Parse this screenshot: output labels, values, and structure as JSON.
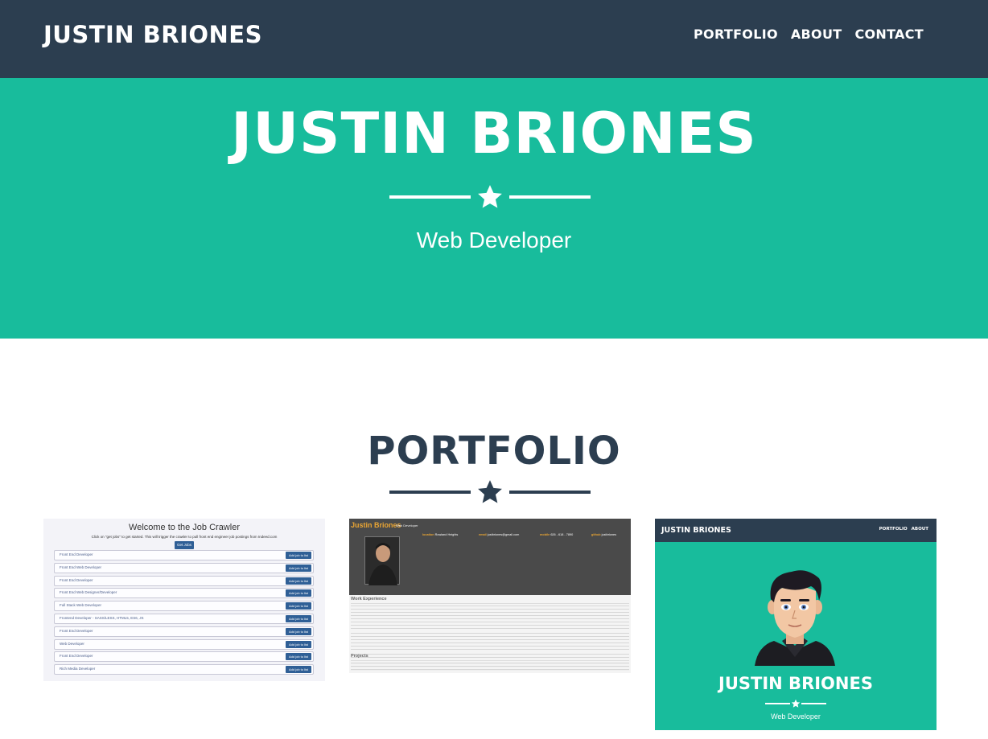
{
  "navbar": {
    "brand": "JUSTIN BRIONES",
    "links": [
      "PORTFOLIO",
      "ABOUT",
      "CONTACT"
    ]
  },
  "hero": {
    "title": "JUSTIN BRIONES",
    "subtitle": "Web Developer"
  },
  "portfolio": {
    "title": "PORTFOLIO",
    "job_crawler": {
      "title": "Welcome to the Job Crawler",
      "description": "Click on \"get jobs\" to get started. This will trigger the crawler to pull front end engineer job postings from Indeed.com",
      "get_jobs_label": "Get Jobs",
      "add_label": "Add job to list",
      "jobs": [
        "Front End Developer",
        "Front End Web Developer",
        "Front End Developer",
        "Front End Web Designer/Developer",
        "Full Stack Web Developer",
        "Frontend Developer - SASS/LESS, HTML5, ES6, JS",
        "Front End Developer",
        "Web Developer",
        "Front End Developer",
        "Rich Media Developer"
      ]
    },
    "resume": {
      "name": "Justin Briones",
      "role": "Web Developer",
      "info": [
        {
          "label": "location",
          "value": "Rowland Heights"
        },
        {
          "label": "email",
          "value": "justbriones@gmail.com"
        },
        {
          "label": "mobile",
          "value": "626 - 618 - 7890"
        },
        {
          "label": "github",
          "value": "justbriones"
        }
      ],
      "work_title": "Work Experience",
      "projects_title": "Projects"
    },
    "mini_site": {
      "brand": "JUSTIN BRIONES",
      "links": "PORTFOLIO ABOUT",
      "title": "JUSTIN BRIONES",
      "subtitle": "Web Developer"
    }
  },
  "colors": {
    "navy": "#2c3e50",
    "teal": "#18bc9c",
    "white": "#ffffff"
  }
}
